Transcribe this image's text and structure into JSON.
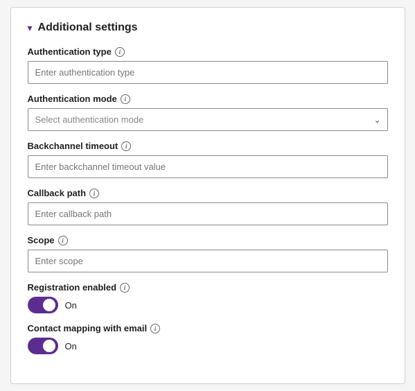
{
  "section": {
    "title": "Additional settings",
    "chevron": "▾"
  },
  "fields": {
    "auth_type": {
      "label": "Authentication type",
      "placeholder": "Enter authentication type"
    },
    "auth_mode": {
      "label": "Authentication mode",
      "placeholder": "Select authentication mode",
      "options": [
        "Select authentication mode"
      ]
    },
    "backchannel_timeout": {
      "label": "Backchannel timeout",
      "placeholder": "Enter backchannel timeout value"
    },
    "callback_path": {
      "label": "Callback path",
      "placeholder": "Enter callback path"
    },
    "scope": {
      "label": "Scope",
      "placeholder": "Enter scope"
    },
    "registration_enabled": {
      "label": "Registration enabled",
      "toggle_label": "On"
    },
    "contact_mapping": {
      "label": "Contact mapping with email",
      "toggle_label": "On"
    }
  }
}
